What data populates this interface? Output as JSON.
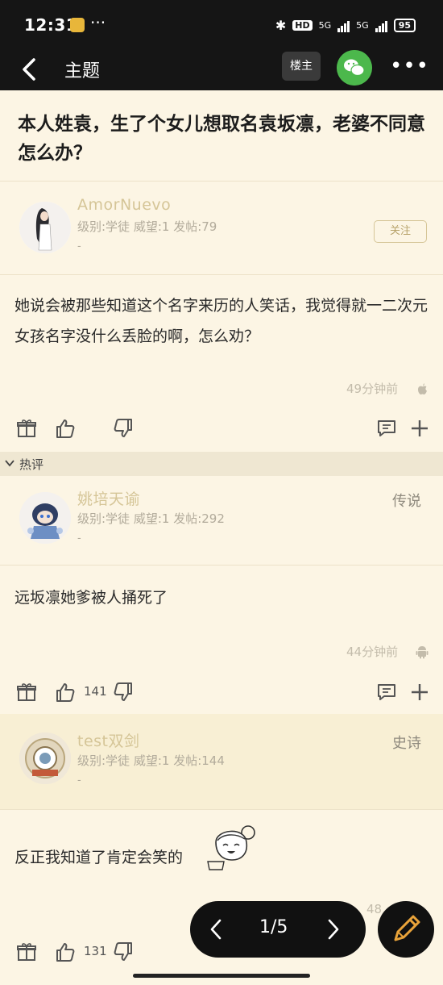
{
  "status_bar": {
    "time": "12:31",
    "more": "···",
    "network_badge": "HD",
    "net_1": "5G",
    "net_2": "5G",
    "battery": "95"
  },
  "app_bar": {
    "title": "主题",
    "op_label": "楼主"
  },
  "thread": {
    "title": "本人姓袁，生了个女儿想取名袁坂凛，老婆不同意怎么办？"
  },
  "posts": [
    {
      "username": "AmorNuevo",
      "meta": "级别:学徒 威望:1 发帖:79",
      "dash": "-",
      "follow_label": "关注",
      "content": "她说会被那些知道这个名字来历的人笑话，我觉得就一二次元女孩名字没什么丢脸的啊，怎么劝？",
      "time": "49分钟前",
      "os_icon": "apple-icon"
    },
    {
      "username": "姚培天谕",
      "meta": "级别:学徒 威望:1 发帖:292",
      "dash": "-",
      "rank": "传说",
      "content": "远坂凛她爹被人捅死了",
      "time": "44分钟前",
      "os_icon": "android-icon",
      "likes": "141"
    },
    {
      "username": "test双剑",
      "meta": "级别:学徒 威望:1 发帖:144",
      "dash": "-",
      "rank": "史诗",
      "content": "反正我知道了肯定会笑的",
      "time": "48",
      "likes": "131"
    }
  ],
  "hot_section": {
    "label": "热评"
  },
  "pager": {
    "text": "1/5"
  },
  "colors": {
    "background": "#fcf5e4",
    "bar": "#151515",
    "username": "#d5c597",
    "hot_bar": "#efe7d2"
  }
}
